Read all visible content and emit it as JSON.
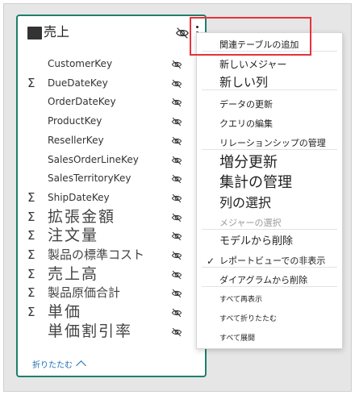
{
  "table": {
    "title": "売上",
    "collapse_label": "折りたたむ",
    "fields": [
      {
        "label": "CustomerKey",
        "sigma": false,
        "size": "small"
      },
      {
        "label": "DueDateKey",
        "sigma": true,
        "size": "small"
      },
      {
        "label": "OrderDateKey",
        "sigma": false,
        "size": "small"
      },
      {
        "label": "ProductKey",
        "sigma": false,
        "size": "small"
      },
      {
        "label": "ResellerKey",
        "sigma": false,
        "size": "small"
      },
      {
        "label": "SalesOrderLineKey",
        "sigma": false,
        "size": "small"
      },
      {
        "label": "SalesTerritoryKey",
        "sigma": false,
        "size": "small"
      },
      {
        "label": "ShipDateKey",
        "sigma": true,
        "size": "small"
      },
      {
        "label": "拡張金額",
        "sigma": true,
        "size": "big"
      },
      {
        "label": "注文量",
        "sigma": true,
        "size": "big"
      },
      {
        "label": "製品の標準コスト",
        "sigma": true,
        "size": "mid"
      },
      {
        "label": "売上高",
        "sigma": true,
        "size": "big"
      },
      {
        "label": "製品原価合計",
        "sigma": true,
        "size": "mid"
      },
      {
        "label": "単価",
        "sigma": true,
        "size": "big"
      },
      {
        "label": "単価割引率",
        "sigma": false,
        "size": "big"
      }
    ]
  },
  "context_menu": {
    "items": [
      {
        "label": "関連テーブルの追加",
        "size": 11,
        "disabled": false,
        "checked": false
      },
      {
        "label": "新しいメジャー",
        "size": 12,
        "disabled": false,
        "checked": false
      },
      {
        "label": "新しい列",
        "size": 15,
        "disabled": false,
        "checked": false
      },
      {
        "label": "データの更新",
        "size": 11,
        "disabled": false,
        "checked": false
      },
      {
        "label": "クエリの編集",
        "size": 11,
        "disabled": false,
        "checked": false
      },
      {
        "label": "リレーションシップの管理",
        "size": 11,
        "disabled": false,
        "checked": false
      },
      {
        "label": "増分更新",
        "size": 18,
        "disabled": false,
        "checked": false
      },
      {
        "label": "集計の管理",
        "size": 18,
        "disabled": false,
        "checked": false
      },
      {
        "label": "列の選択",
        "size": 16,
        "disabled": false,
        "checked": false
      },
      {
        "label": "メジャーの選択",
        "size": 11,
        "disabled": true,
        "checked": false
      },
      {
        "label": "モデルから削除",
        "size": 13,
        "disabled": false,
        "checked": false
      },
      {
        "label": "レポートビューでの非表示",
        "size": 11,
        "disabled": false,
        "checked": true
      },
      {
        "label": "ダイアグラムから削除",
        "size": 11,
        "disabled": false,
        "checked": false
      },
      {
        "label": "すべて再表示",
        "size": 9,
        "disabled": false,
        "checked": false
      },
      {
        "label": "すべて折りたたむ",
        "size": 9,
        "disabled": false,
        "checked": false
      },
      {
        "label": "すべて展開",
        "size": 9,
        "disabled": false,
        "checked": false
      }
    ]
  },
  "icons": {
    "header_visibility": "eye-off-icon",
    "field_visibility": "eye-off-icon",
    "more_options": "vertical-ellipsis-icon",
    "table": "table-icon",
    "collapse": "chevron-up-icon",
    "check": "checkmark-icon"
  },
  "colors": {
    "card_border": "#1e7f6e",
    "highlight": "#e8323c",
    "link": "#1e6fb8"
  }
}
